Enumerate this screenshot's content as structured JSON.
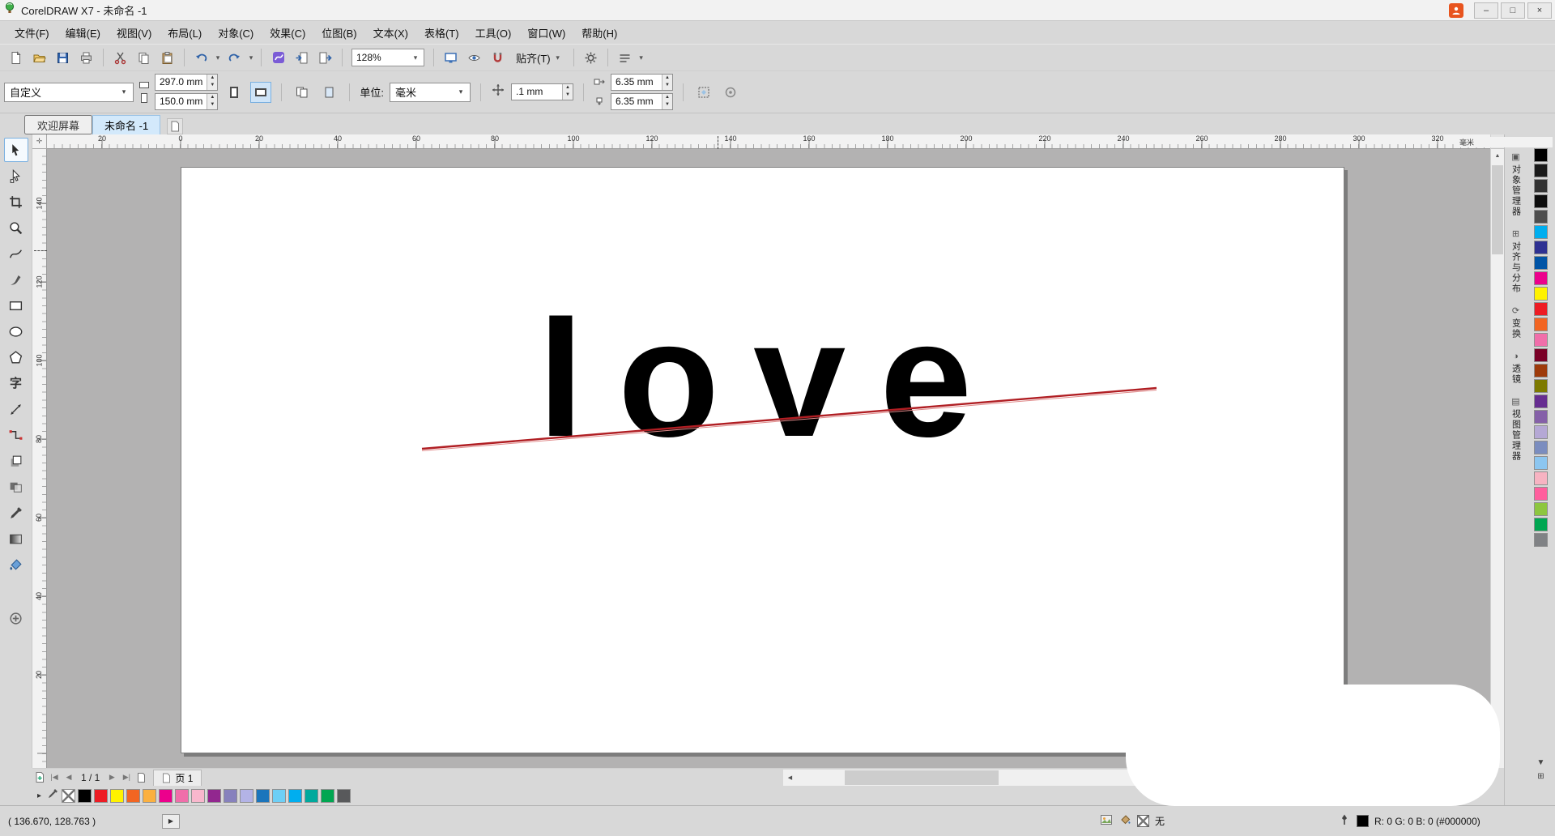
{
  "window": {
    "title": "CorelDRAW X7 - 未命名 -1",
    "minimize": "–",
    "maximize": "□",
    "close": "×"
  },
  "menu": {
    "items": [
      "文件(F)",
      "编辑(E)",
      "视图(V)",
      "布局(L)",
      "对象(C)",
      "效果(C)",
      "位图(B)",
      "文本(X)",
      "表格(T)",
      "工具(O)",
      "窗口(W)",
      "帮助(H)"
    ]
  },
  "toolbar": {
    "zoom_value": "128%",
    "snap_label": "贴齐(T)"
  },
  "propbar": {
    "preset": "自定义",
    "page_width": "297.0 mm",
    "page_height": "150.0 mm",
    "units_label": "单位:",
    "units_value": "毫米",
    "nudge_value": ".1 mm",
    "duplicate_x": "6.35 mm",
    "duplicate_y": "6.35 mm"
  },
  "doctabs": {
    "welcome": "欢迎屏幕",
    "document": "未命名 -1"
  },
  "rulers": {
    "h_labels": [
      "20",
      "0",
      "20",
      "40",
      "60",
      "80",
      "100",
      "120",
      "140",
      "160",
      "180",
      "200",
      "220",
      "240",
      "260",
      "280",
      "300",
      "320"
    ],
    "v_labels": [
      "140",
      "120",
      "100",
      "80",
      "60",
      "40",
      "20"
    ],
    "unit": "毫米"
  },
  "canvas": {
    "artwork_text": "love"
  },
  "toolbox": {
    "text_tool_glyph": "字",
    "tools": [
      "pick",
      "shape",
      "crop",
      "zoom",
      "freehand",
      "artistic-media",
      "rectangle",
      "ellipse",
      "polygon",
      "text",
      "parallel-dimension",
      "connector",
      "drop-shadow",
      "transparency",
      "color-eyedropper",
      "interactive-fill",
      "smart-fill"
    ]
  },
  "dockers": {
    "tabs": [
      {
        "icon": "▣",
        "label": "对象管理器"
      },
      {
        "icon": "⊞",
        "label": "对齐与分布"
      },
      {
        "icon": "⟳",
        "label": "变换"
      },
      {
        "icon": "◑",
        "label": "透镜"
      },
      {
        "icon": "▤",
        "label": "视图管理器"
      }
    ]
  },
  "palette_right": {
    "colors": [
      "#000000",
      "#1a1a1a",
      "#333333",
      "#0d0d0d",
      "#4d4d4d",
      "#00aeef",
      "#2e3192",
      "#0054a6",
      "#ec008c",
      "#fff200",
      "#ed1c24",
      "#f26522",
      "#f06eaa",
      "#7a0026",
      "#9e3b0b",
      "#7d7a00",
      "#662d91",
      "#8560a8",
      "#b5a8d5",
      "#7b8dbf",
      "#8cc6f0",
      "#f7b3c2",
      "#ff5e9d",
      "#8dc63f",
      "#00a651",
      "#808285"
    ]
  },
  "palette_bottom": {
    "colors": [
      "#000000",
      "#ed1c24",
      "#fff200",
      "#f26522",
      "#fbb040",
      "#ec008c",
      "#f06eaa",
      "#f9b7cd",
      "#92278f",
      "#8781bd",
      "#b3b3e6",
      "#1b75bc",
      "#6dcff6",
      "#00aeef",
      "#00a99d",
      "#00a651",
      "#58595b"
    ]
  },
  "page_nav": {
    "first": "|◀",
    "prev": "◀",
    "counter": "1 / 1",
    "next": "▶",
    "last": "▶|",
    "page_tab": "页 1"
  },
  "glyphs": {
    "dropdown": "▾",
    "up": "▲",
    "down": "▼",
    "left": "◀",
    "right": "▶",
    "flyout": "▸",
    "collapse": "«",
    "palette_options": "⊞",
    "expand": "▶",
    "origin": "✛"
  },
  "status_bar": {
    "coords": "( 136.670, 128.763 )",
    "fill_label": "无",
    "outline_label": "R: 0 G: 0 B: 0 (#000000)"
  }
}
